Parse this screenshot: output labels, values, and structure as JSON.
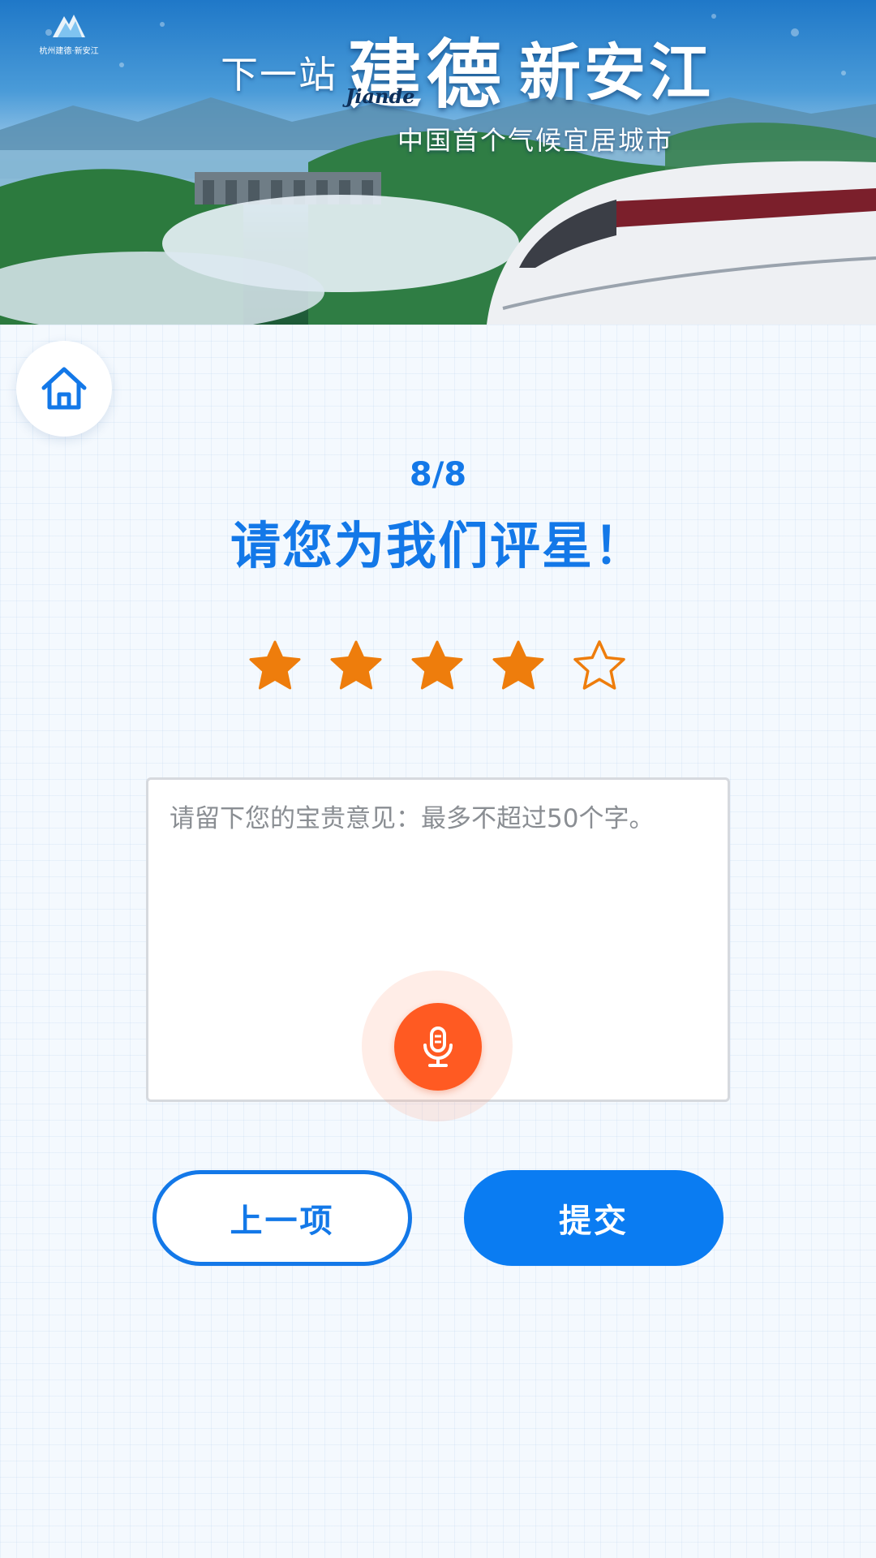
{
  "banner": {
    "logo_text": "杭州建德·新安江",
    "prefix": "下一站",
    "city": "建德",
    "city_pinyin": "Jiande",
    "subcity": "新安江",
    "slogan": "中国首个气候宜居城市"
  },
  "home_icon": "home-icon",
  "step": {
    "counter": "8/8"
  },
  "title": "请您为我们评星！",
  "rating": {
    "value": 4,
    "max": 5,
    "filled_color": "#ee7d0c",
    "empty_color": "#ee7d0c"
  },
  "feedback": {
    "value": "",
    "placeholder": "请留下您的宝贵意见：最多不超过50个字。"
  },
  "mic": {
    "icon": "microphone-icon",
    "color": "#ff5a22"
  },
  "buttons": {
    "prev_label": "上一项",
    "submit_label": "提交"
  },
  "colors": {
    "primary": "#1378e8",
    "accent": "#ff5a22",
    "star": "#ee7d0c"
  }
}
